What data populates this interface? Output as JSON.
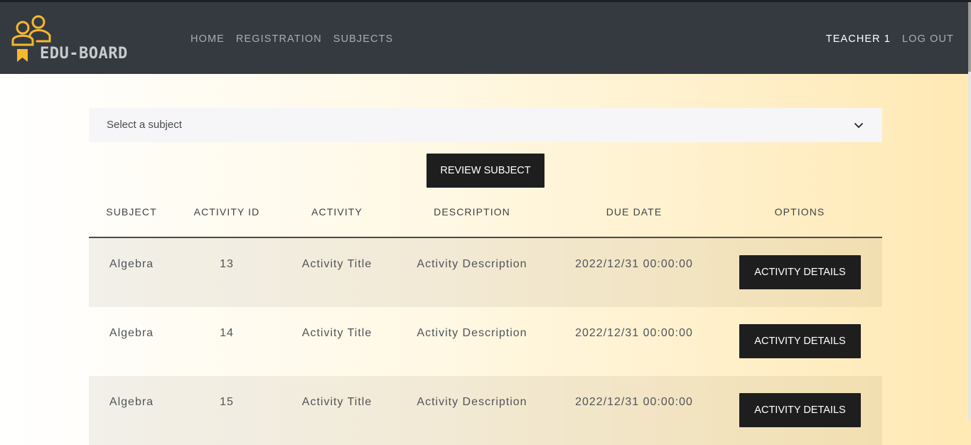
{
  "brand": {
    "name": "EDU-BOARD",
    "accent": "#f5b82e"
  },
  "nav": {
    "links": [
      "HOME",
      "REGISTRATION",
      "SUBJECTS"
    ],
    "user": "TEACHER 1",
    "logout": "LOG OUT"
  },
  "subject_select": {
    "placeholder": "Select a subject",
    "icon": "chevron-down-icon"
  },
  "review_button": "REVIEW SUBJECT",
  "table": {
    "headers": [
      "SUBJECT",
      "ACTIVITY ID",
      "ACTIVITY",
      "DESCRIPTION",
      "DUE DATE",
      "OPTIONS"
    ],
    "rows": [
      {
        "subject": "Algebra",
        "id": "13",
        "activity": "Activity Title",
        "description": "Activity Description",
        "due": "2022/12/31 00:00:00",
        "option": "ACTIVITY DETAILS"
      },
      {
        "subject": "Algebra",
        "id": "14",
        "activity": "Activity Title",
        "description": "Activity Description",
        "due": "2022/12/31 00:00:00",
        "option": "ACTIVITY DETAILS"
      },
      {
        "subject": "Algebra",
        "id": "15",
        "activity": "Activity Title",
        "description": "Activity Description",
        "due": "2022/12/31 00:00:00",
        "option": "ACTIVITY DETAILS"
      }
    ]
  }
}
